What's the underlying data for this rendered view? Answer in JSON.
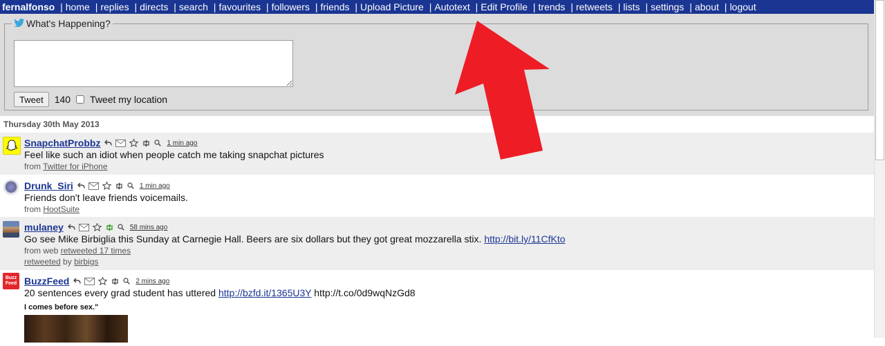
{
  "nav": {
    "user": "fernalfonso",
    "links": [
      "home",
      "replies",
      "directs",
      "search",
      "favourites",
      "followers",
      "friends",
      "Upload Picture",
      "Autotext",
      "Edit Profile",
      "trends",
      "retweets",
      "lists",
      "settings",
      "about",
      "logout"
    ]
  },
  "compose": {
    "legend": "What's Happening?",
    "textarea_value": "",
    "button_label": "Tweet",
    "char_count": "140",
    "location_label": "Tweet my location",
    "location_checked": false
  },
  "timeline": {
    "date": "Thursday 30th May 2013",
    "tweets": [
      {
        "user": "SnapchatProbbz",
        "time": "1 min ago",
        "text": "Feel like such an idiot when people catch me taking snapchat pictures",
        "from_prefix": "from",
        "source": "Twitter for iPhone"
      },
      {
        "user": "Drunk_Siri",
        "time": "1 min ago",
        "text": "Friends don't leave friends voicemails.",
        "from_prefix": "from",
        "source": "HootSuite"
      },
      {
        "user": "mulaney",
        "time": "58 mins ago",
        "text": "Go see Mike Birbiglia this Sunday at Carnegie Hall. Beers are six dollars but they got great mozzarella stix.",
        "link": "http://bit.ly/11CfKto",
        "from_prefix": "from web",
        "retweet_count_text": "retweeted 17 times",
        "retweeted_label": "retweeted",
        "by_text": "by",
        "retweeted_by": "birbigs"
      },
      {
        "user": "BuzzFeed",
        "time": "2 mins ago",
        "text": "20 sentences every grad student has uttered",
        "link": "http://bzfd.it/1365U3Y",
        "link2": "http://t.co/0d9wqNzGd8",
        "image_caption": "I comes before sex.\""
      }
    ]
  },
  "colors": {
    "nav_bg": "#1a3592",
    "compose_bg": "#dcdcdc",
    "row_alt": "#eeeeee",
    "link": "#1a3592",
    "arrow": "#ee1c25"
  },
  "icons": [
    "twitter-bird-icon",
    "reply-icon",
    "direct-message-icon",
    "favourite-star-icon",
    "retweet-icon",
    "search-icon",
    "snapchat-ghost-icon"
  ]
}
